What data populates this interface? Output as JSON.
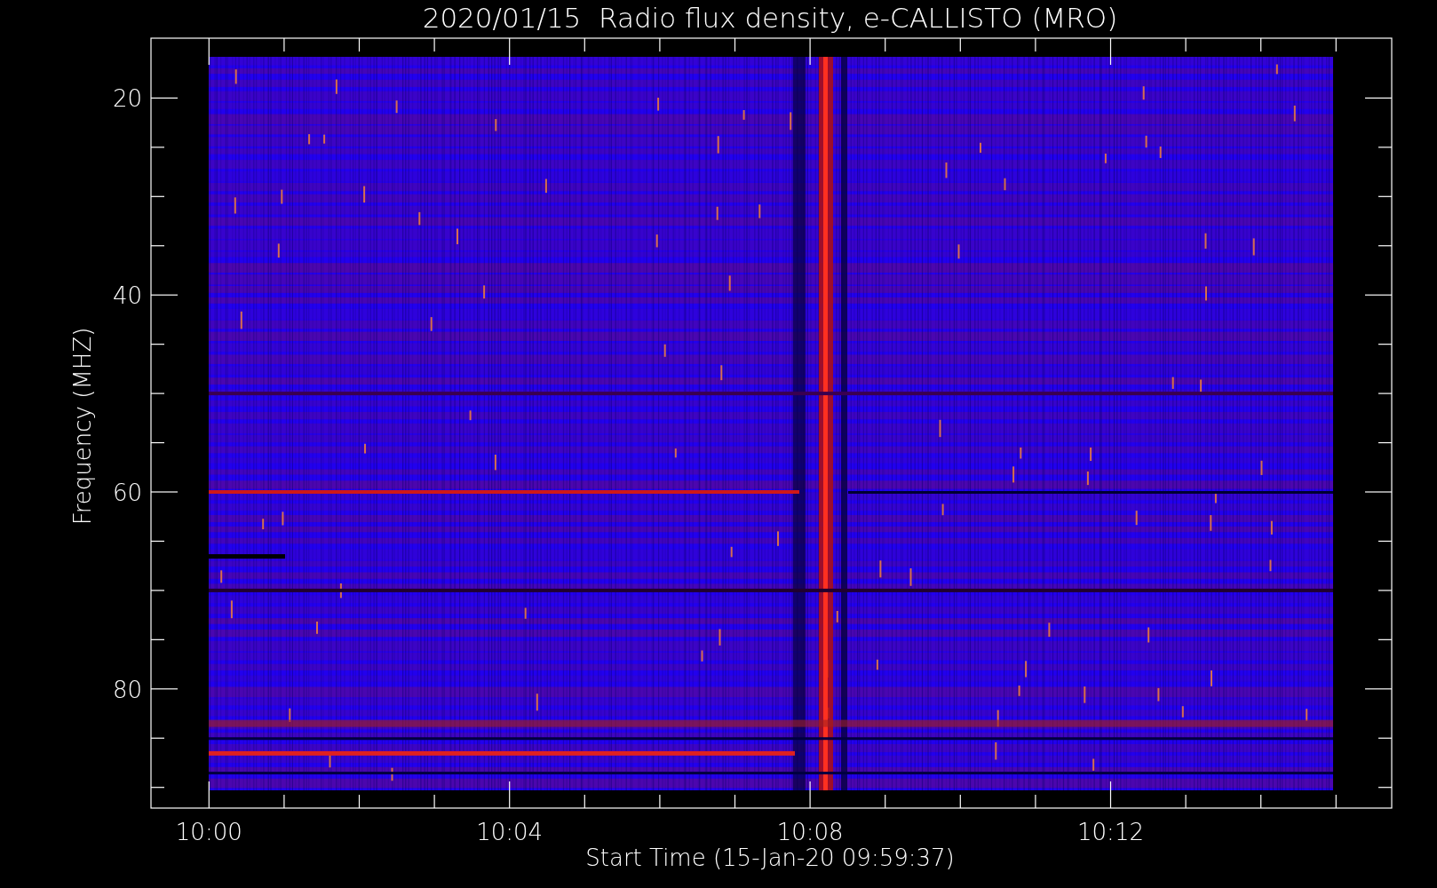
{
  "plot": {
    "title": "2020/01/15  Radio flux density, e-CALLISTO (MRO)",
    "y_axis": {
      "label": "Frequency (MHZ)",
      "ticks": [
        "20",
        "40",
        "60",
        "80"
      ]
    },
    "x_axis": {
      "label": "Start Time (15-Jan-20 09:59:37)",
      "ticks": [
        "10:00",
        "10:04",
        "10:08",
        "10:12"
      ]
    }
  }
}
